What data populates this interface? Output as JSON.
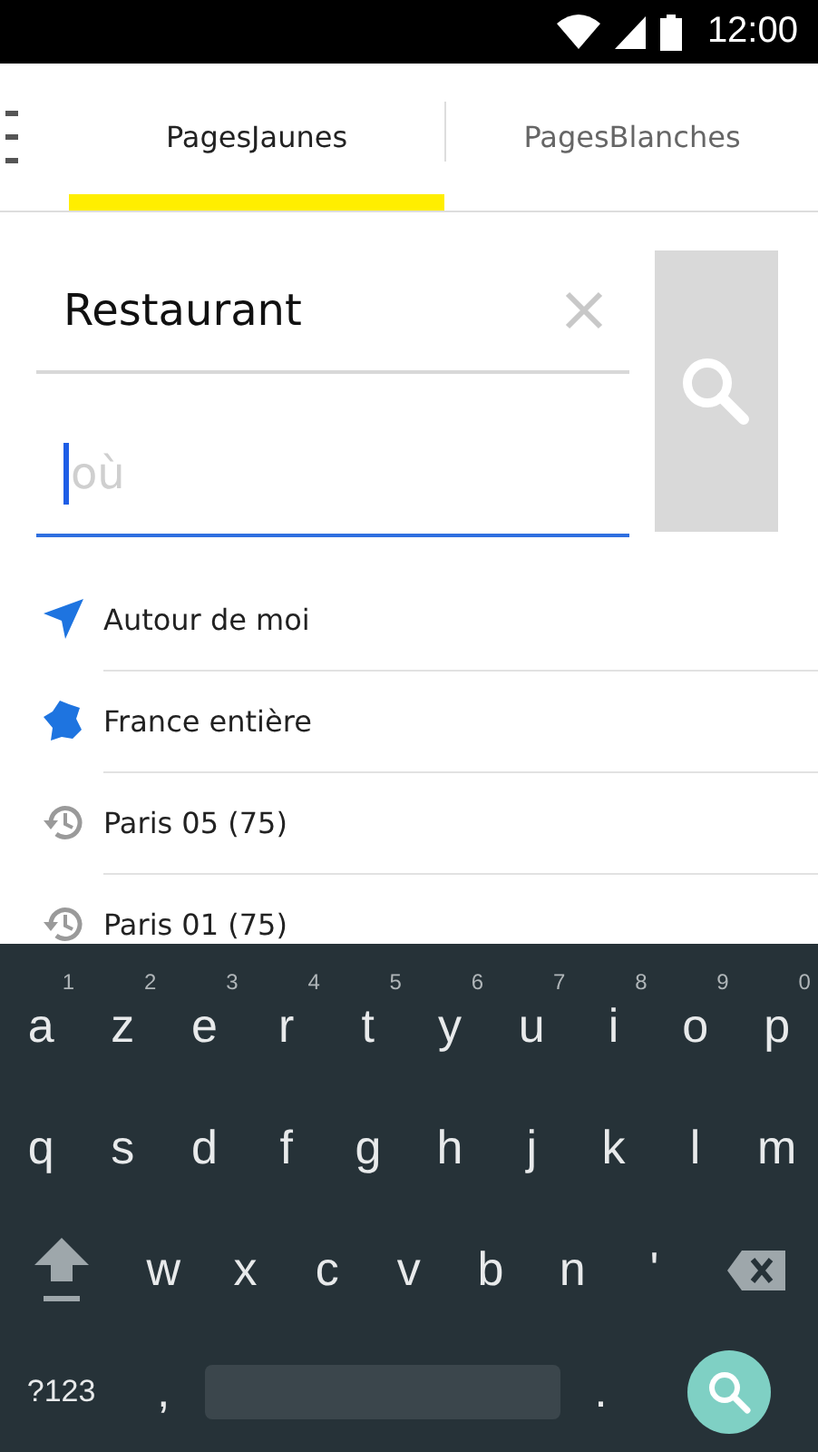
{
  "status_bar": {
    "time": "12:00"
  },
  "tabs": [
    {
      "label": "PagesJaunes",
      "selected": true
    },
    {
      "label": "PagesBlanches",
      "selected": false
    }
  ],
  "search": {
    "what": {
      "value": "Restaurant"
    },
    "where": {
      "placeholder": "où",
      "focused": true
    }
  },
  "suggestions": [
    {
      "kind": "location",
      "label": "Autour de moi"
    },
    {
      "kind": "country",
      "label": "France entière"
    },
    {
      "kind": "history",
      "label": "Paris 05 (75)"
    },
    {
      "kind": "history",
      "label": "Paris 01 (75)"
    }
  ],
  "keyboard": {
    "rows": [
      [
        {
          "kind": "letter",
          "label": "a",
          "hint": "1"
        },
        {
          "kind": "letter",
          "label": "z",
          "hint": "2"
        },
        {
          "kind": "letter",
          "label": "e",
          "hint": "3"
        },
        {
          "kind": "letter",
          "label": "r",
          "hint": "4"
        },
        {
          "kind": "letter",
          "label": "t",
          "hint": "5"
        },
        {
          "kind": "letter",
          "label": "y",
          "hint": "6"
        },
        {
          "kind": "letter",
          "label": "u",
          "hint": "7"
        },
        {
          "kind": "letter",
          "label": "i",
          "hint": "8"
        },
        {
          "kind": "letter",
          "label": "o",
          "hint": "9"
        },
        {
          "kind": "letter",
          "label": "p",
          "hint": "0"
        }
      ],
      [
        {
          "kind": "letter",
          "label": "q"
        },
        {
          "kind": "letter",
          "label": "s"
        },
        {
          "kind": "letter",
          "label": "d"
        },
        {
          "kind": "letter",
          "label": "f"
        },
        {
          "kind": "letter",
          "label": "g"
        },
        {
          "kind": "letter",
          "label": "h"
        },
        {
          "kind": "letter",
          "label": "j"
        },
        {
          "kind": "letter",
          "label": "k"
        },
        {
          "kind": "letter",
          "label": "l"
        },
        {
          "kind": "letter",
          "label": "m"
        }
      ],
      [
        {
          "kind": "shift"
        },
        {
          "kind": "letter",
          "label": "w"
        },
        {
          "kind": "letter",
          "label": "x"
        },
        {
          "kind": "letter",
          "label": "c"
        },
        {
          "kind": "letter",
          "label": "v"
        },
        {
          "kind": "letter",
          "label": "b"
        },
        {
          "kind": "letter",
          "label": "n"
        },
        {
          "kind": "letter",
          "label": "'"
        },
        {
          "kind": "backspace"
        }
      ],
      [
        {
          "kind": "symbols",
          "label": "?123"
        },
        {
          "kind": "letter",
          "label": ","
        },
        {
          "kind": "space"
        },
        {
          "kind": "letter",
          "label": "."
        },
        {
          "kind": "search"
        }
      ]
    ]
  }
}
